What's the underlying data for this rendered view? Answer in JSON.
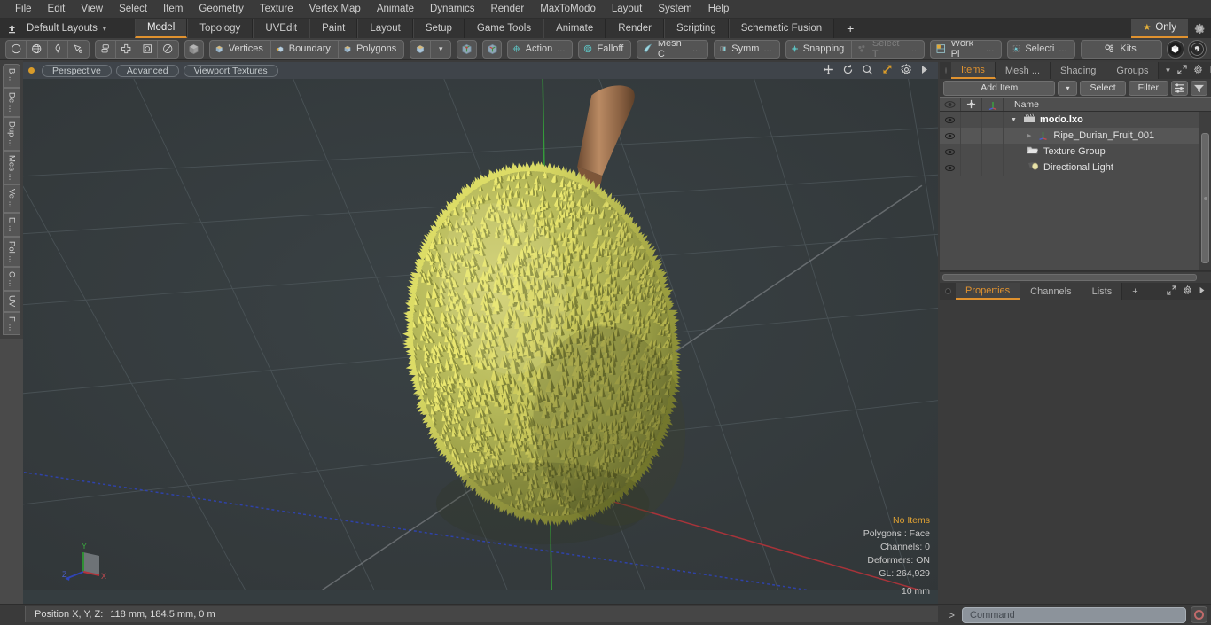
{
  "app": {
    "title": "Modo",
    "document": "modo.lxo"
  },
  "menubar": {
    "items": [
      {
        "label": "File"
      },
      {
        "label": "Edit"
      },
      {
        "label": "View"
      },
      {
        "label": "Select"
      },
      {
        "label": "Item"
      },
      {
        "label": "Geometry"
      },
      {
        "label": "Texture"
      },
      {
        "label": "Vertex Map"
      },
      {
        "label": "Animate"
      },
      {
        "label": "Dynamics"
      },
      {
        "label": "Render"
      },
      {
        "label": "MaxToModo"
      },
      {
        "label": "Layout"
      },
      {
        "label": "System"
      },
      {
        "label": "Help"
      }
    ]
  },
  "layoutbar": {
    "home_icon": "home-arrow-icon",
    "layouts_label": "Default Layouts",
    "layouts_caret": "▾",
    "tabs": [
      {
        "label": "Model",
        "active": true
      },
      {
        "label": "Topology",
        "active": false
      },
      {
        "label": "UVEdit",
        "active": false
      },
      {
        "label": "Paint",
        "active": false
      },
      {
        "label": "Layout",
        "active": false
      },
      {
        "label": "Setup",
        "active": false
      },
      {
        "label": "Game Tools",
        "active": false
      },
      {
        "label": "Animate",
        "active": false
      },
      {
        "label": "Render",
        "active": false
      },
      {
        "label": "Scripting",
        "active": false
      },
      {
        "label": "Schematic Fusion",
        "active": false
      }
    ],
    "add_tab": "+",
    "only_label": "Only",
    "only_star": "★",
    "gear_icon": "gear-icon"
  },
  "toolbar": {
    "shape_tools": [
      {
        "icon": "circle-icon"
      },
      {
        "icon": "globe-icon"
      },
      {
        "icon": "pen-icon"
      },
      {
        "icon": "brush-icon"
      }
    ],
    "mesh_ops": [
      {
        "icon": "stack-layers-icon"
      },
      {
        "icon": "grid-plus-icon"
      },
      {
        "icon": "bounded-circle-icon"
      },
      {
        "icon": "sphere-slice-icon"
      }
    ],
    "solo_icon": "cube-grey-icon",
    "selection_modes": [
      {
        "label": "Vertices",
        "icon": "cube-vertices-icon"
      },
      {
        "label": "Boundary",
        "icon": "cube-boundary-icon"
      },
      {
        "label": "Polygons",
        "icon": "cube-polygons-icon"
      }
    ],
    "mode_extra_icon": "cube-blue-icon",
    "mode_extra_caret": "▾",
    "action_center_icons": [
      "cube-axis-icon",
      "cube-axis-alt-icon"
    ],
    "modifiers": [
      {
        "label": "Action",
        "suffix": "...",
        "icon": "action-center-icon",
        "disabled": false
      },
      {
        "label": "Falloff",
        "suffix": "",
        "icon": "falloff-icon",
        "disabled": false
      },
      {
        "label": "Mesh C",
        "suffix": "...",
        "icon": "mesh-constraint-icon",
        "disabled": false
      }
    ],
    "symmetry": {
      "label": "Symm",
      "suffix": "...",
      "icon": "symmetry-icon"
    },
    "snapping": {
      "label": "Snapping",
      "icon": "snapping-icon"
    },
    "select_through": {
      "label": "Select T",
      "suffix": "...",
      "icon": "select-through-icon",
      "disabled": true
    },
    "work_plane": {
      "label": "Work Pl",
      "suffix": "...",
      "icon": "work-plane-icon"
    },
    "selection_set": {
      "label": "Selecti",
      "suffix": "...",
      "icon": "selection-icon"
    },
    "kits": {
      "label": "Kits",
      "icon": "kits-gear-icon"
    },
    "app_icons": [
      {
        "icon": "modo-cube-icon"
      },
      {
        "icon": "unreal-engine-icon"
      }
    ]
  },
  "left_tabs": [
    {
      "label": "B ..."
    },
    {
      "label": "De ..."
    },
    {
      "label": "Dup ..."
    },
    {
      "label": "Mes ..."
    },
    {
      "label": "Ve ..."
    },
    {
      "label": "E ..."
    },
    {
      "label": "Pol ..."
    },
    {
      "label": "C ..."
    },
    {
      "label": "UV"
    },
    {
      "label": "F ..."
    }
  ],
  "viewport": {
    "header": {
      "indicator": "active-dot",
      "view_mode": "Perspective",
      "shading": "Advanced",
      "textures": "Viewport Textures",
      "icons": [
        {
          "icon": "move-icon"
        },
        {
          "icon": "rotate-icon"
        },
        {
          "icon": "zoom-icon"
        },
        {
          "icon": "fit-icon"
        },
        {
          "icon": "gear-icon"
        },
        {
          "icon": "play-icon"
        }
      ]
    },
    "background_color": "#353d40",
    "grid_color": "#4a5356",
    "axes": {
      "x_color": "#b4333a",
      "y_color": "#35a03a",
      "z_color": "#2f44b5",
      "gizmo_labels": {
        "x": "X",
        "y": "Y",
        "z": "Z"
      }
    },
    "model": {
      "name": "Ripe Durian Fruit",
      "body_color": "#a8a84e",
      "spike_highlight": "#cfcf6a",
      "spike_shadow": "#767a32",
      "stem_color": "#9a6f4e"
    },
    "stats": {
      "selection": "No Items",
      "polygons": "Polygons : Face",
      "channels": "Channels: 0",
      "deformers": "Deformers: ON",
      "gl": "GL: 264,929"
    },
    "scale": "10 mm"
  },
  "right_panel": {
    "top_tabs": [
      {
        "label": "Items",
        "active": true
      },
      {
        "label": "Mesh ...",
        "active": false
      },
      {
        "label": "Shading",
        "active": false
      },
      {
        "label": "Groups",
        "active": false
      }
    ],
    "top_tab_icons": [
      {
        "icon": "chevron-down-icon"
      },
      {
        "icon": "expand-icon"
      },
      {
        "icon": "gear-icon"
      },
      {
        "icon": "play-icon"
      }
    ],
    "controls": {
      "add_item": "Add Item",
      "add_item_caret": "▾",
      "select": "Select",
      "filter": "Filter",
      "list_icon": "list-options-icon",
      "funnel_icon": "funnel-icon"
    },
    "tree_header": {
      "eye_icon": "eye-icon",
      "lock_icon": "move-cross-icon",
      "axis_icon": "axis-icon",
      "name_col": "Name"
    },
    "tree_rows": [
      {
        "label": "modo.lxo",
        "icon": "clapperboard-icon",
        "level": 0,
        "bold": true,
        "expander": "▼",
        "selected": false
      },
      {
        "label": "Ripe_Durian_Fruit_001",
        "icon": "axis-icon",
        "level": 1,
        "bold": false,
        "expander": "▶",
        "selected": true
      },
      {
        "label": "Texture Group",
        "icon": "folder-icon",
        "level": 1,
        "bold": false,
        "expander": "",
        "selected": false
      },
      {
        "label": "Directional Light",
        "icon": "light-icon",
        "level": 1,
        "bold": false,
        "expander": "",
        "selected": false
      }
    ],
    "bottom_tabs": [
      {
        "label": "Properties",
        "active": true
      },
      {
        "label": "Channels",
        "active": false
      },
      {
        "label": "Lists",
        "active": false
      },
      {
        "label": "+",
        "active": false
      }
    ],
    "bottom_tab_icons": [
      {
        "icon": "expand-icon"
      },
      {
        "icon": "gear-icon"
      },
      {
        "icon": "play-icon"
      }
    ]
  },
  "statusbar": {
    "position_label": "Position X, Y, Z:",
    "position_value": "118 mm, 184.5 mm, 0 m",
    "command_prompt": ">",
    "command_placeholder": "Command",
    "record_icon": "record-icon"
  }
}
